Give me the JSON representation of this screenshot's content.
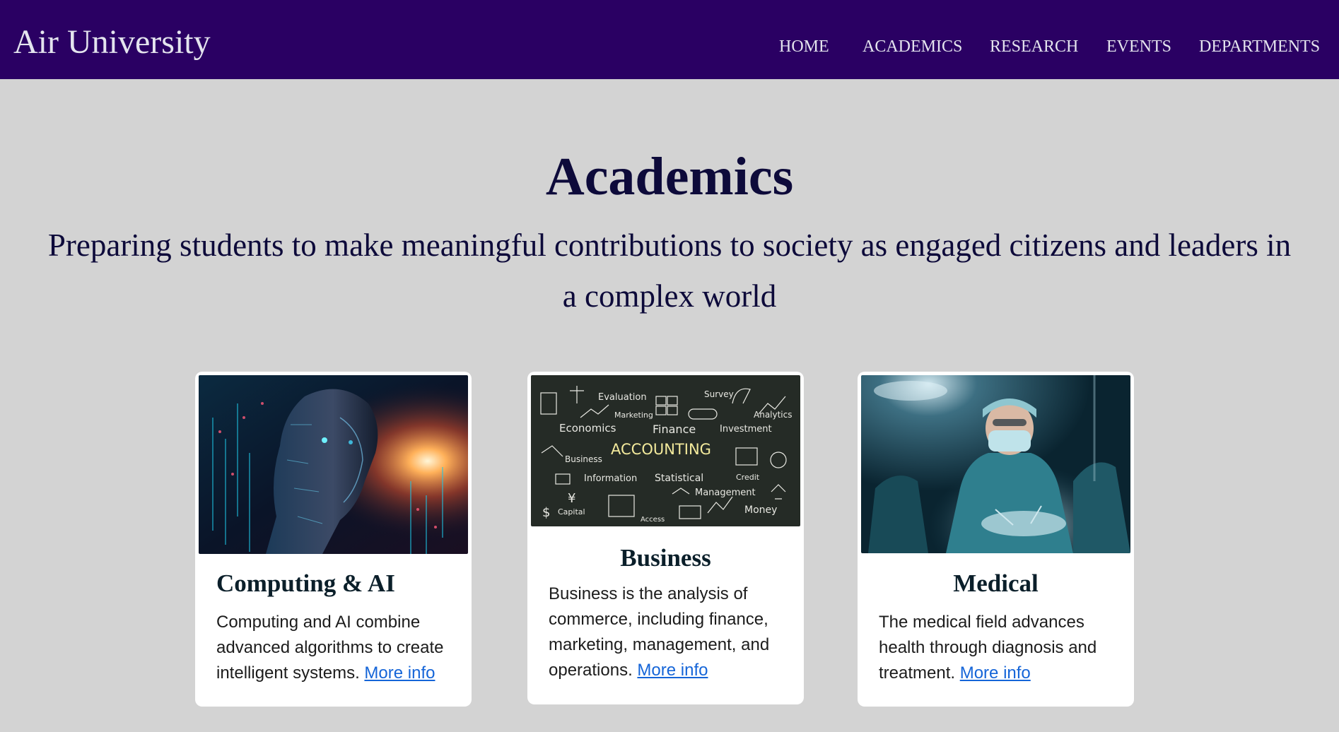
{
  "header": {
    "brand": "Air University",
    "nav": [
      "HOME",
      "ACADEMICS",
      "RESEARCH",
      "EVENTS",
      "DEPARTMENTS"
    ]
  },
  "hero": {
    "title": "Academics",
    "subtitle_line1": "Preparing students to make meaningful contributions to society as engaged citizens and leaders in",
    "subtitle_line2": "a complex world"
  },
  "cards": [
    {
      "title": "Computing & AI",
      "text": "Computing and AI combine advanced algorithms to create intelligent systems. ",
      "link": "More info",
      "image": "ai-face-image"
    },
    {
      "title": "Business",
      "text": "Business is the analysis of commerce, including finance, marketing, management, and operations. ",
      "link": "More info",
      "image": "accounting-chalkboard-image",
      "image_words": [
        "Evaluation",
        "Survey",
        "Marketing",
        "Analytics",
        "Economics",
        "Finance",
        "Investment",
        "ACCOUNTING",
        "Business",
        "Information",
        "Statistical",
        "Credit",
        "Management",
        "Capital",
        "Access",
        "Money"
      ]
    },
    {
      "title": "Medical",
      "text": "The medical field advances health through diagnosis and treatment. ",
      "link": "More info",
      "image": "surgeon-operating-image"
    }
  ],
  "colors": {
    "header_bg": "#2a0063",
    "page_bg": "#d3d3d3",
    "heading_text": "#0d0a3a",
    "link": "#1565d8"
  }
}
